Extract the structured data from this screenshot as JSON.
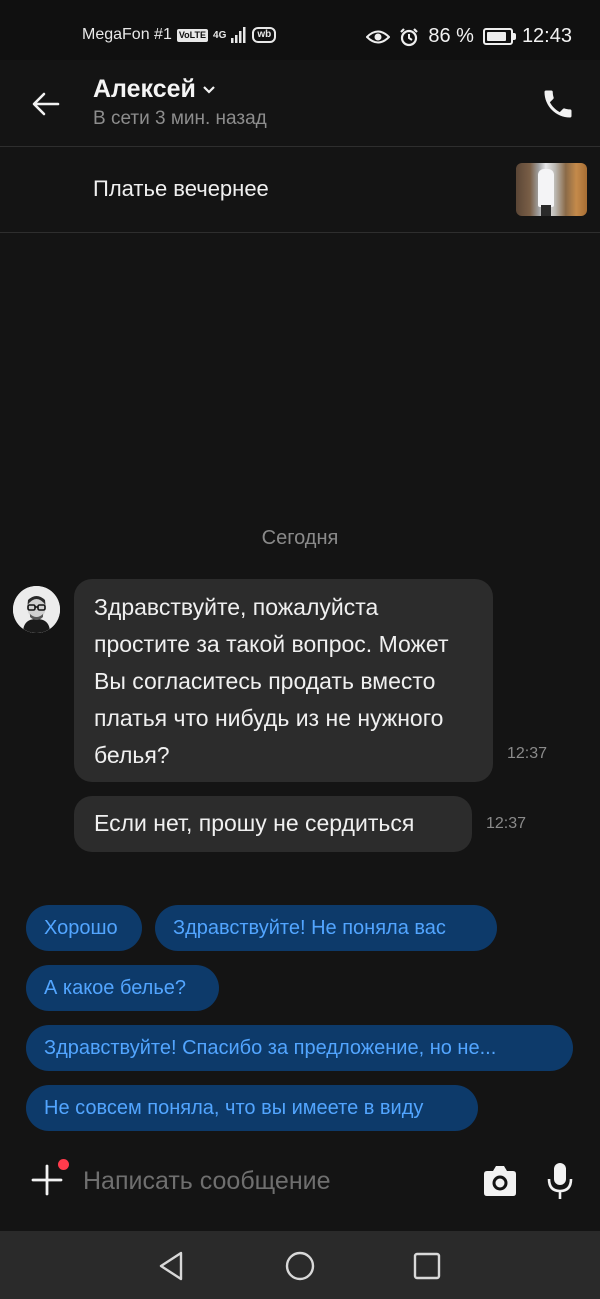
{
  "status_bar": {
    "carrier": "MegaFon #1",
    "volte": "VoLTE",
    "network": "4G",
    "app_badge": "wb",
    "battery": "86 %",
    "battery_level": 0.86,
    "time": "12:43"
  },
  "header": {
    "contact_name": "Алексей",
    "contact_status": "В сети 3 мин. назад"
  },
  "product": {
    "title": "Платье вечернее"
  },
  "chat": {
    "date_separator": "Сегодня",
    "messages": [
      {
        "text": "Здравствуйте, пожалуйста простите за такой вопрос. Может Вы согласитесь продать вместо платья что нибудь из не нужного белья?",
        "time": "12:37"
      },
      {
        "text": "Если нет, прошу не сердиться",
        "time": "12:37"
      }
    ]
  },
  "quick_replies": [
    "Хорошо",
    "Здравствуйте! Не поняла вас",
    "А какое белье?",
    "Здравствуйте! Спасибо за предложение, но не...",
    "Не совсем поняла, что вы имеете в виду"
  ],
  "composer": {
    "placeholder": "Написать сообщение"
  },
  "colors": {
    "background": "#141414",
    "bubble": "#2c2c2c",
    "chip_bg": "#0d3a6a",
    "chip_text": "#52a5ff",
    "notification_dot": "#ff3b4c"
  }
}
